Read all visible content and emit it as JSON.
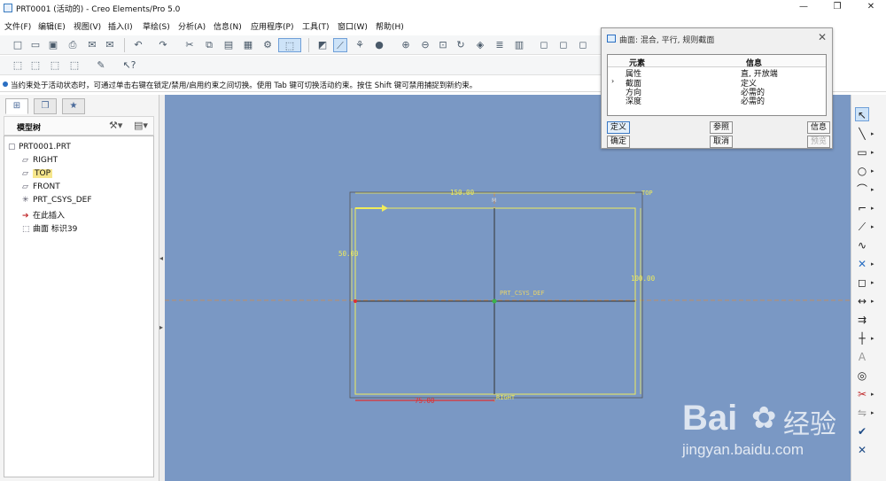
{
  "window": {
    "title": "PRT0001 (活动的) - Creo Elements/Pro 5.0",
    "controls": {
      "minimize": "—",
      "restore": "❐",
      "close": "✕"
    }
  },
  "menubar": [
    "文件(F)",
    "编辑(E)",
    "视图(V)",
    "插入(I)",
    "草绘(S)",
    "分析(A)",
    "信息(N)",
    "应用程序(P)",
    "工具(T)",
    "窗口(W)",
    "帮助(H)"
  ],
  "status_message": "当约束处于活动状态时，可通过单击右键在锁定/禁用/启用约束之间切换。使用 Tab 键可切换活动约束。按住 Shift 键可禁用捕捉到新约束。",
  "left_panel": {
    "header": "模型树",
    "tree": [
      {
        "label": "PRT0001.PRT",
        "icon": "part-icon"
      },
      {
        "label": "RIGHT",
        "icon": "datum-plane-icon"
      },
      {
        "label": "TOP",
        "icon": "datum-plane-icon",
        "selected": true
      },
      {
        "label": "FRONT",
        "icon": "datum-plane-icon"
      },
      {
        "label": "PRT_CSYS_DEF",
        "icon": "csys-icon"
      },
      {
        "label": "在此插入",
        "icon": "insert-here-icon"
      },
      {
        "label": "曲面 标识39",
        "icon": "surface-icon"
      }
    ]
  },
  "dialog": {
    "title": "曲面: 混合, 平行, 规则截面",
    "columns": [
      "元素",
      "信息"
    ],
    "rows": [
      {
        "element": "属性",
        "info": "直, 开放端"
      },
      {
        "element": "截面",
        "info": "定义"
      },
      {
        "element": "方向",
        "info": "必需的"
      },
      {
        "element": "深度",
        "info": "必需的"
      }
    ],
    "buttons": {
      "define": "定义",
      "reference": "参照",
      "info": "信息",
      "ok": "确定",
      "cancel": "取消",
      "preview": "预览"
    }
  },
  "sketch": {
    "dims": {
      "top": "150.00",
      "left": "50.00",
      "right": "100.00",
      "bottom": "75.00"
    },
    "labels": {
      "top_plane": "TOP",
      "right_plane": "RIGHT",
      "csys": "PRT_CSYS_DEF",
      "m_mark": "M"
    }
  },
  "watermark": {
    "brand": "Bai",
    "cn": "经验",
    "url": "jingyan.baidu.com"
  },
  "colors": {
    "graphics_bg": "#7a98c4",
    "sketch_yellow": "#f0ec5a",
    "dim_red": "#e03030"
  }
}
